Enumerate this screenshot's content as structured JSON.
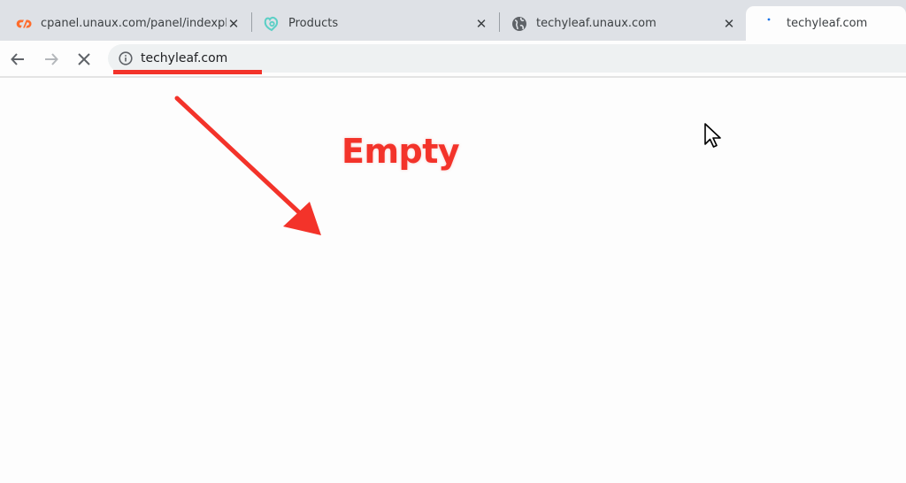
{
  "browser": {
    "tabs": [
      {
        "title": "cpanel.unaux.com/panel/indexpl",
        "favicon": "cpanel-icon",
        "active": false,
        "closable": true
      },
      {
        "title": "Products",
        "favicon": "products-logo-icon",
        "active": false,
        "closable": true
      },
      {
        "title": "techyleaf.unaux.com",
        "favicon": "globe-icon",
        "active": false,
        "closable": true
      },
      {
        "title": "techyleaf.com",
        "favicon": "loading-spinner-icon",
        "active": true,
        "closable": false
      }
    ],
    "close_glyph": "✕",
    "toolbar": {
      "back_icon": "arrow-left-icon",
      "forward_icon": "arrow-right-icon",
      "stop_icon": "stop-loading-icon",
      "site_info_icon": "info-icon",
      "url": "techyleaf.com"
    }
  },
  "annotation": {
    "label": "Empty",
    "color": "#f3332a"
  },
  "colors": {
    "tabstrip": "#dee1e6",
    "omnibox": "#eef1f2",
    "page": "#fdfdfd",
    "cpanel_orange": "#ff6c2c",
    "products_teal": "#5ccfc6",
    "spinner_blue": "#1a73e8"
  }
}
